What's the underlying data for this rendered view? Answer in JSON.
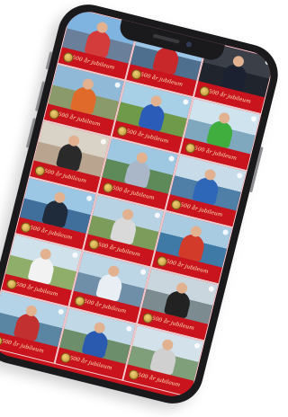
{
  "screen_banner_text": "500 år jubileum",
  "tiles": [
    {
      "scene": "kayaker-on-boat-deck",
      "sky": "#7fb3e0",
      "ground": "#6a7f99",
      "figure": "#d43c3c",
      "caption": "500 år jubileum"
    },
    {
      "scene": "white-ship-harbor",
      "sky": "#9cc7e8",
      "ground": "#4f6f8f",
      "figure": "#c8282a",
      "caption": "500 år jubileum"
    },
    {
      "scene": "man-in-suit-portrait",
      "sky": "#3a3f48",
      "ground": "#20252d",
      "figure": "#1b2130",
      "caption": "500 år jubileum"
    },
    {
      "scene": "woman-kneeling-outdoors",
      "sky": "#8fb9d6",
      "ground": "#8a9a6a",
      "figure": "#e06a2a",
      "caption": "500 år jubileum"
    },
    {
      "scene": "team-in-blue-shirts",
      "sky": "#a7cfe6",
      "ground": "#6e9a4a",
      "figure": "#2b5cb8",
      "caption": "500 år jubileum"
    },
    {
      "scene": "green-kayak-rapids",
      "sky": "#cfe3ee",
      "ground": "#7fa8bf",
      "figure": "#3fae3f",
      "caption": "500 år jubileum"
    },
    {
      "scene": "woman-long-hair-portrait",
      "sky": "#d9d2c7",
      "ground": "#b9a58f",
      "figure": "#2a2a2a",
      "caption": "500 år jubileum"
    },
    {
      "scene": "man-by-lake",
      "sky": "#9ec8e2",
      "ground": "#5e8a5a",
      "figure": "#a9b7c9",
      "caption": "500 år jubileum"
    },
    {
      "scene": "paddler-in-blue-boat",
      "sky": "#c7dbe9",
      "ground": "#4f7ea6",
      "figure": "#2e67b8",
      "caption": "500 år jubileum"
    },
    {
      "scene": "canoeist-paddling",
      "sky": "#9bc6e4",
      "ground": "#3f6f9a",
      "figure": "#1f2b3a",
      "caption": "500 år jubileum"
    },
    {
      "scene": "couple-on-shore",
      "sky": "#b6d2e3",
      "ground": "#7c9c5c",
      "figure": "#d9d9d9",
      "caption": "500 år jubileum"
    },
    {
      "scene": "red-kayak-lake",
      "sky": "#a9cbe2",
      "ground": "#3f7aa6",
      "figure": "#d23a2a",
      "caption": "500 år jubileum"
    },
    {
      "scene": "woman-in-white",
      "sky": "#cfe1ea",
      "ground": "#8fae6a",
      "figure": "#f2f2f2",
      "caption": "500 år jubileum"
    },
    {
      "scene": "two-kayakers-dock",
      "sky": "#bcd6e6",
      "ground": "#6f8fa8",
      "figure": "#e9eef4",
      "caption": "500 år jubileum"
    },
    {
      "scene": "woman-in-dark-coat",
      "sky": "#c9d6de",
      "ground": "#7b8b8f",
      "figure": "#222222",
      "caption": "500 år jubileum"
    },
    {
      "scene": "lake-scene",
      "sky": "#b5d3e6",
      "ground": "#5b86a3",
      "figure": "#c23030",
      "caption": "500 år jubileum"
    },
    {
      "scene": "river-scene",
      "sky": "#c1d9e7",
      "ground": "#6c8e6a",
      "figure": "#2a5ab0",
      "caption": "500 år jubileum"
    },
    {
      "scene": "shore-scene",
      "sky": "#d3e2ea",
      "ground": "#7f9f7a",
      "figure": "#d0d0d0",
      "caption": "500 år jubileum"
    }
  ]
}
